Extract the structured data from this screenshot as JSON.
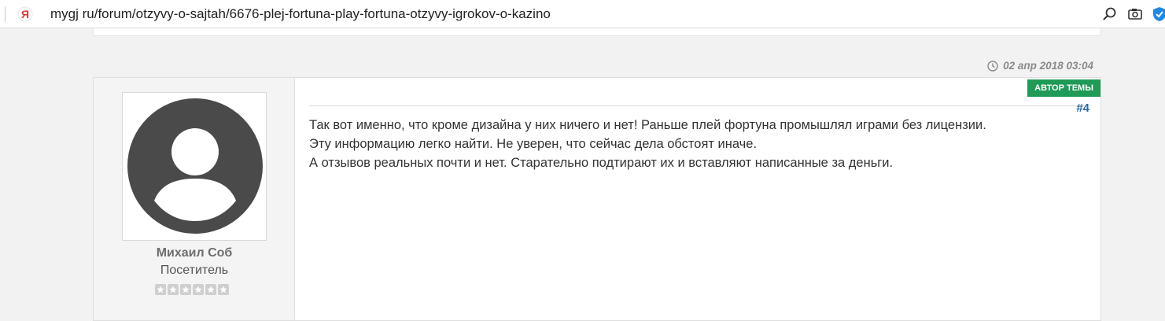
{
  "browser": {
    "url": "mygj ru/forum/otzyvy-o-sajtah/6676-plej-fortuna-play-fortuna-otzyvy-igrokov-o-kazino",
    "site_icon": "yandex-logo-icon",
    "tools": [
      "search-icon",
      "camera-icon",
      "shield-icon"
    ]
  },
  "post": {
    "date": "02 апр 2018 03:04",
    "badge": "Автор темы",
    "number": "#4",
    "author": {
      "name": "Михаил Соб",
      "role": "Посетитель",
      "rating_stars": 0,
      "rating_max": 6
    },
    "body": {
      "lines": [
        "Так вот именно, что кроме дизайна у них ничего и нет! Раньше плей фортуна промышлял играми без лицензии.",
        "Эту информацию легко найти. Не уверен, что сейчас дела обстоят иначе.",
        "А отзывов реальных почти и нет. Старательно подтирают их и вставляют написанные за деньги."
      ]
    }
  },
  "colors": {
    "badge_bg": "#1f9a57",
    "post_number": "#2b6aa6",
    "avatar_bg": "#4a4a4a",
    "page_bg": "#f2f2f2"
  }
}
